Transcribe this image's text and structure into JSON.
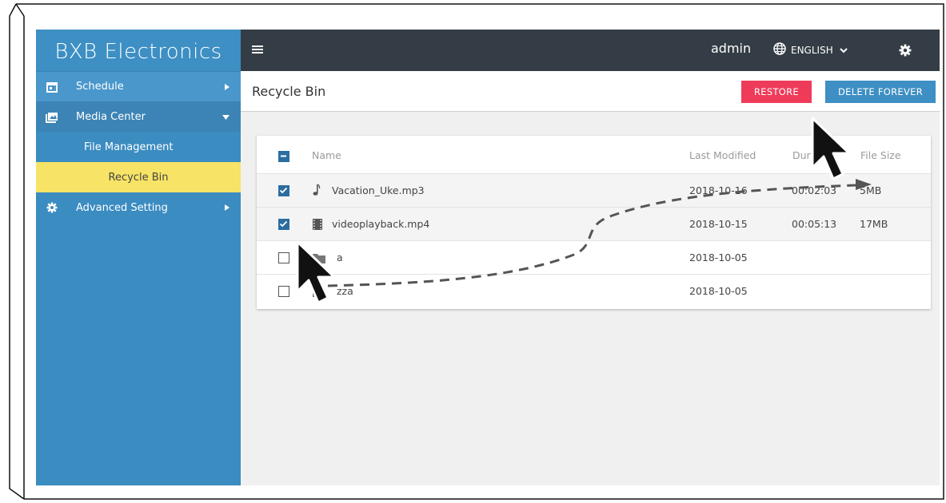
{
  "app": {
    "brand": "BXB Electronics"
  },
  "sidebar": {
    "items": [
      {
        "label": "Schedule",
        "icon": "calendar-icon"
      },
      {
        "label": "Media Center",
        "icon": "photo-library-icon"
      },
      {
        "label": "File Management"
      },
      {
        "label": "Recycle Bin"
      },
      {
        "label": "Advanced Setting",
        "icon": "gear-icon"
      }
    ]
  },
  "topbar": {
    "user": "admin",
    "language": "ENGLISH"
  },
  "header": {
    "title": "Recycle Bin",
    "restore_label": "RESTORE",
    "delete_label": "DELETE FOREVER"
  },
  "table": {
    "columns": [
      "Name",
      "Last Modified",
      "Duration",
      "File Size"
    ],
    "rows": [
      {
        "checked": true,
        "icon": "music-note-icon",
        "name": "Vacation_Uke.mp3",
        "modified": "2018-10-16",
        "duration": "00:02:03",
        "size": "5MB"
      },
      {
        "checked": true,
        "icon": "film-icon",
        "name": "videoplayback.mp4",
        "modified": "2018-10-15",
        "duration": "00:05:13",
        "size": "17MB"
      },
      {
        "checked": false,
        "icon": "folder-icon",
        "name": "a",
        "modified": "2018-10-05",
        "duration": "",
        "size": ""
      },
      {
        "checked": false,
        "icon": "folder-icon",
        "name": "zza",
        "modified": "2018-10-05",
        "duration": "",
        "size": ""
      }
    ]
  },
  "colors": {
    "sidebar": "#3b8cc1",
    "active": "#f7e365",
    "topbar": "#343d45",
    "restore": "#ef3b5a",
    "delete": "#3d8fc4"
  }
}
